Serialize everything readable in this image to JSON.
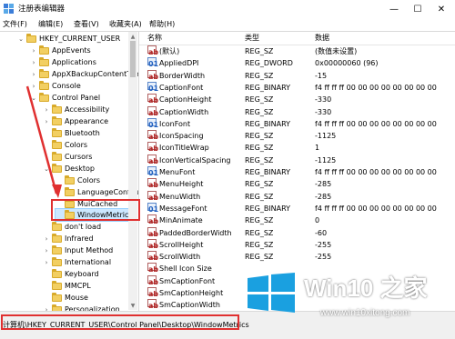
{
  "window": {
    "title": "注册表编辑器",
    "controls": {
      "minimize": "—",
      "maximize": "☐",
      "close": "✕"
    }
  },
  "menu": [
    "文件(F)",
    "编辑(E)",
    "查看(V)",
    "收藏夹(A)",
    "帮助(H)"
  ],
  "tree": [
    {
      "label": "HKEY_CURRENT_USER",
      "expander": "⌄"
    },
    {
      "label": "AppEvents",
      "expander": "›"
    },
    {
      "label": "Applications",
      "expander": "›"
    },
    {
      "label": "AppXBackupContentTyp",
      "expander": "›"
    },
    {
      "label": "Console",
      "expander": "›"
    },
    {
      "label": "Control Panel",
      "expander": "⌄"
    },
    {
      "label": "Accessibility",
      "expander": "›"
    },
    {
      "label": "Appearance",
      "expander": "›"
    },
    {
      "label": "Bluetooth",
      "expander": ""
    },
    {
      "label": "Colors",
      "expander": ""
    },
    {
      "label": "Cursors",
      "expander": ""
    },
    {
      "label": "Desktop",
      "expander": "⌄"
    },
    {
      "label": "Colors",
      "expander": ""
    },
    {
      "label": "LanguageConfigu",
      "expander": ""
    },
    {
      "label": "MuiCached",
      "expander": ""
    },
    {
      "label": "WindowMetrics",
      "expander": ""
    },
    {
      "label": "don't load",
      "expander": ""
    },
    {
      "label": "Infrared",
      "expander": "›"
    },
    {
      "label": "Input Method",
      "expander": "›"
    },
    {
      "label": "International",
      "expander": "›"
    },
    {
      "label": "Keyboard",
      "expander": ""
    },
    {
      "label": "MMCPL",
      "expander": ""
    },
    {
      "label": "Mouse",
      "expander": ""
    },
    {
      "label": "Personalization",
      "expander": "›"
    }
  ],
  "list": {
    "headers": {
      "name": "名称",
      "type": "类型",
      "data": "数据"
    },
    "rows": [
      {
        "icon": "ab",
        "name": "(默认)",
        "type": "REG_SZ",
        "data": "(数值未设置)"
      },
      {
        "icon": "bin",
        "name": "AppliedDPI",
        "type": "REG_DWORD",
        "data": "0x00000060 (96)"
      },
      {
        "icon": "ab",
        "name": "BorderWidth",
        "type": "REG_SZ",
        "data": "-15"
      },
      {
        "icon": "bin",
        "name": "CaptionFont",
        "type": "REG_BINARY",
        "data": "f4 ff ff ff 00 00 00 00 00 00 00 00"
      },
      {
        "icon": "ab",
        "name": "CaptionHeight",
        "type": "REG_SZ",
        "data": "-330"
      },
      {
        "icon": "ab",
        "name": "CaptionWidth",
        "type": "REG_SZ",
        "data": "-330"
      },
      {
        "icon": "bin",
        "name": "IconFont",
        "type": "REG_BINARY",
        "data": "f4 ff ff ff 00 00 00 00 00 00 00 00"
      },
      {
        "icon": "ab",
        "name": "IconSpacing",
        "type": "REG_SZ",
        "data": "-1125"
      },
      {
        "icon": "ab",
        "name": "IconTitleWrap",
        "type": "REG_SZ",
        "data": "1"
      },
      {
        "icon": "ab",
        "name": "IconVerticalSpacing",
        "type": "REG_SZ",
        "data": "-1125"
      },
      {
        "icon": "bin",
        "name": "MenuFont",
        "type": "REG_BINARY",
        "data": "f4 ff ff ff 00 00 00 00 00 00 00 00"
      },
      {
        "icon": "ab",
        "name": "MenuHeight",
        "type": "REG_SZ",
        "data": "-285"
      },
      {
        "icon": "ab",
        "name": "MenuWidth",
        "type": "REG_SZ",
        "data": "-285"
      },
      {
        "icon": "bin",
        "name": "MessageFont",
        "type": "REG_BINARY",
        "data": "f4 ff ff ff 00 00 00 00 00 00 00 00"
      },
      {
        "icon": "ab",
        "name": "MinAnimate",
        "type": "REG_SZ",
        "data": "0"
      },
      {
        "icon": "ab",
        "name": "PaddedBorderWidth",
        "type": "REG_SZ",
        "data": "-60"
      },
      {
        "icon": "ab",
        "name": "ScrollHeight",
        "type": "REG_SZ",
        "data": "-255"
      },
      {
        "icon": "ab",
        "name": "ScrollWidth",
        "type": "REG_SZ",
        "data": "-255"
      },
      {
        "icon": "ab",
        "name": "Shell Icon Size",
        "type": "",
        "data": ""
      },
      {
        "icon": "ab",
        "name": "SmCaptionFont",
        "type": "",
        "data": ""
      },
      {
        "icon": "ab",
        "name": "SmCaptionHeight",
        "type": "",
        "data": ""
      },
      {
        "icon": "ab",
        "name": "SmCaptionWidth",
        "type": "",
        "data": ""
      }
    ]
  },
  "status": {
    "path": "计算机\\HKEY_CURRENT_USER\\Control Panel\\Desktop\\WindowMetrics"
  },
  "watermark": {
    "title": "Win10 之家",
    "url": "www.win10xitong.com"
  },
  "colors": {
    "annotation": "#e03030",
    "selection": "#cce8ff",
    "logo": "#1aa0e0"
  }
}
